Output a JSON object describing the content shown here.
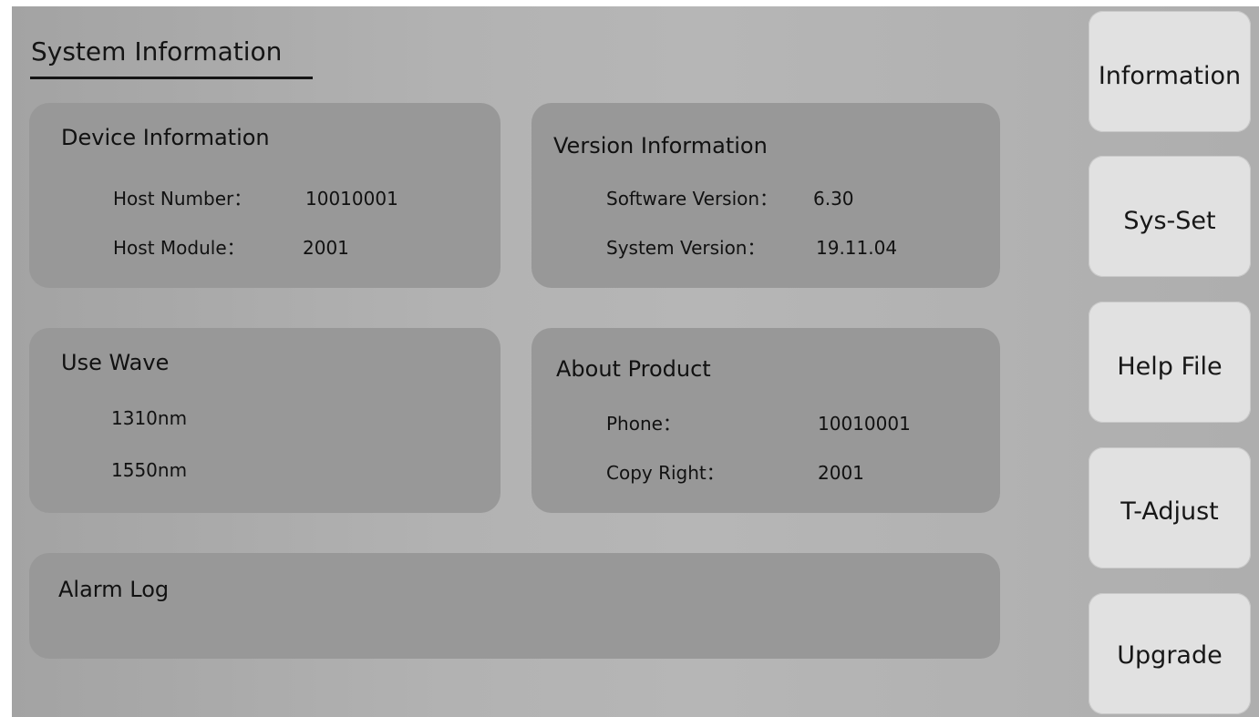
{
  "page": {
    "title": "System Information"
  },
  "device_info": {
    "title": "Device Information",
    "fields": [
      {
        "label": "Host Number：",
        "value": "10010001"
      },
      {
        "label": "Host Module：",
        "value": "2001"
      }
    ]
  },
  "version_info": {
    "title": "Version Information",
    "fields": [
      {
        "label": "Software Version：",
        "value": "6.30"
      },
      {
        "label": "System Version：",
        "value": "19.11.04"
      }
    ]
  },
  "use_wave": {
    "title": "Use Wave",
    "items": [
      "1310nm",
      "1550nm"
    ]
  },
  "about_product": {
    "title": "About Product",
    "fields": [
      {
        "label": "Phone：",
        "value": "10010001"
      },
      {
        "label": "Copy Right：",
        "value": "2001"
      }
    ]
  },
  "alarm_log": {
    "title": "Alarm Log"
  },
  "sidebar": {
    "buttons": [
      {
        "label": "Information"
      },
      {
        "label": "Sys-Set"
      },
      {
        "label": "Help File"
      },
      {
        "label": "T-Adjust"
      },
      {
        "label": "Upgrade"
      }
    ]
  },
  "colors": {
    "background": "#b2b2b2",
    "panel": "#989898",
    "button": "#e1e1e1",
    "text": "#141414"
  }
}
